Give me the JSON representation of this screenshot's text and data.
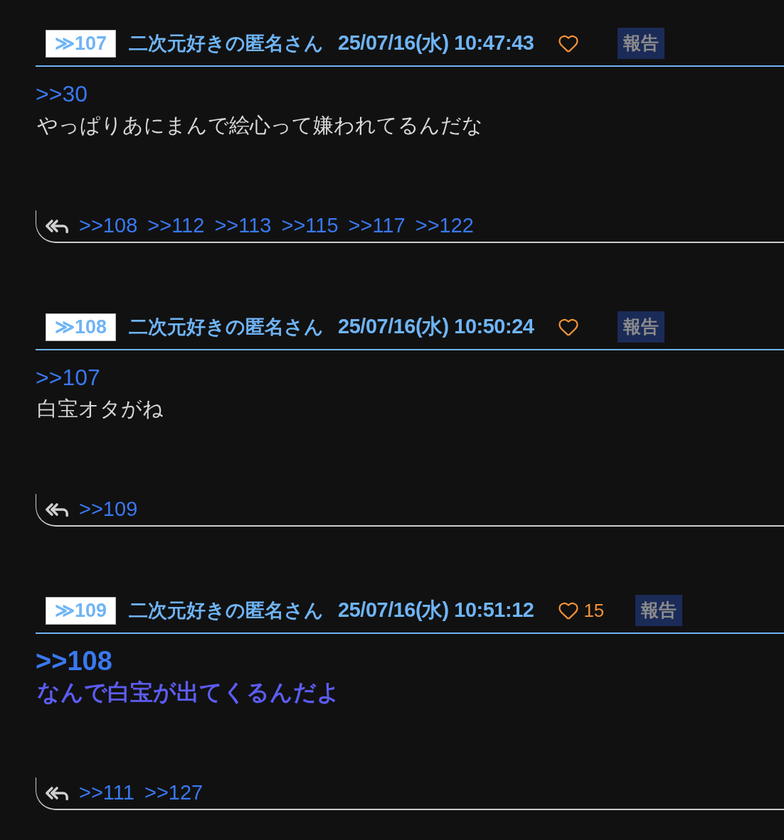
{
  "posts": [
    {
      "number": "≫107",
      "name": "二次元好きの匿名さん",
      "date": "25/07/16(水) 10:47:43",
      "report": "報告",
      "anchor": ">>30",
      "text": "やっぱりあにまんで絵心って嫌われてるんだな",
      "highlighted": false,
      "replies": [
        ">>108",
        ">>112",
        ">>113",
        ">>115",
        ">>117",
        ">>122"
      ]
    },
    {
      "number": "≫108",
      "name": "二次元好きの匿名さん",
      "date": "25/07/16(水) 10:50:24",
      "report": "報告",
      "anchor": ">>107",
      "text": "白宝オタがね",
      "highlighted": false,
      "replies": [
        ">>109"
      ]
    },
    {
      "number": "≫109",
      "name": "二次元好きの匿名さん",
      "date": "25/07/16(水) 10:51:12",
      "likes": "15",
      "report": "報告",
      "anchor": ">>108",
      "text": "なんで白宝が出てくるんだよ",
      "highlighted": true,
      "replies": [
        ">>111",
        ">>127"
      ]
    }
  ]
}
